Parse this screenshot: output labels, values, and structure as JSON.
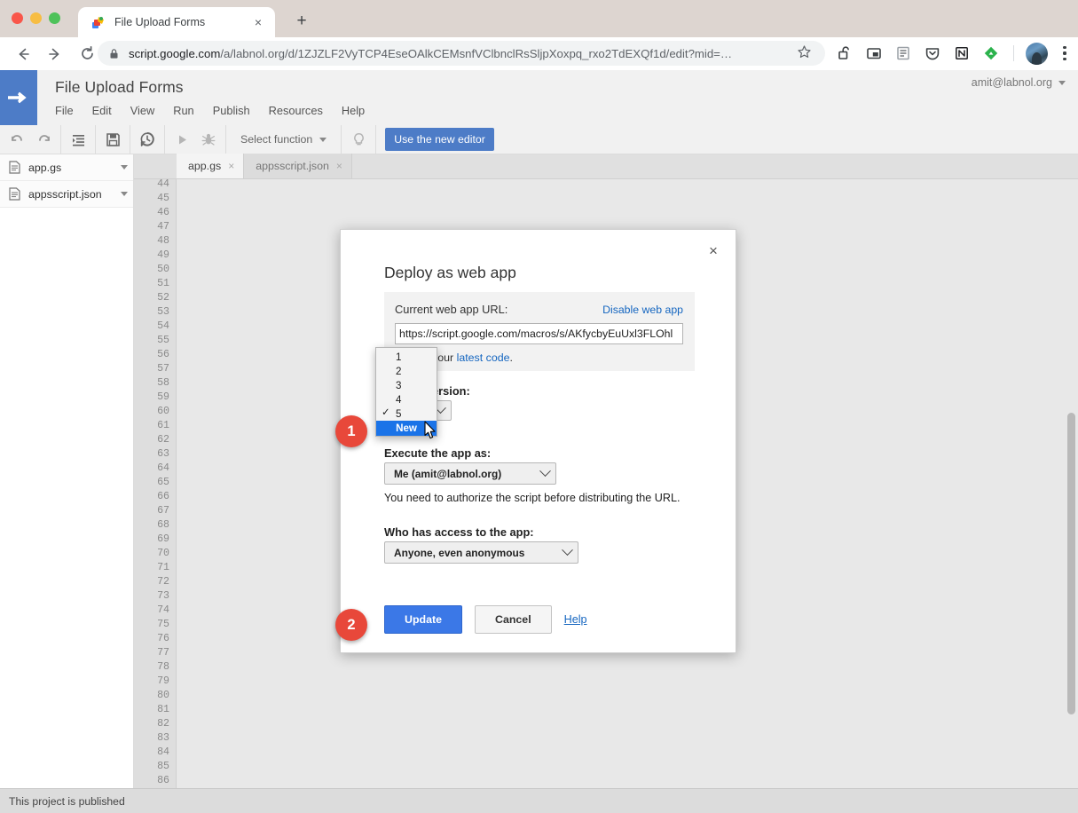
{
  "browser": {
    "tab": {
      "title": "File Upload Forms",
      "favicon": "apps-script-favicon",
      "close": "×"
    },
    "new_tab_label": "+",
    "nav": {
      "back": "←",
      "forward": "→",
      "reload": "⟳"
    },
    "omnibox": {
      "url_secure": "script.google.com",
      "url_path": "/a/labnol.org/d/1ZJZLF2VyTCP4EseOAlkCEMsnfVClbnclRsSljpXoxpq_rxo2TdEXQf1d/edit?mid=…",
      "lock_icon": "lock-icon",
      "star_icon": "star-icon"
    },
    "extensions": [
      {
        "name": "unlock-icon",
        "glyph": "🔓"
      },
      {
        "name": "picture-in-picture-icon",
        "glyph": "▣"
      },
      {
        "name": "reader-mode-icon",
        "glyph": "▤"
      },
      {
        "name": "pocket-icon",
        "glyph": "⛉"
      },
      {
        "name": "notion-icon",
        "glyph": "N"
      },
      {
        "name": "feedly-icon",
        "glyph": "◆"
      }
    ],
    "menu_icon": "kebab-menu-icon"
  },
  "app": {
    "title": "File Upload Forms",
    "account": "amit@labnol.org",
    "menu": [
      "File",
      "Edit",
      "View",
      "Run",
      "Publish",
      "Resources",
      "Help"
    ],
    "toolbar": {
      "undo": "undo-icon",
      "redo": "redo-icon",
      "indent": "indent-icon",
      "save": "save-icon",
      "history": "history-icon",
      "run": "run-icon",
      "debug": "debug-icon",
      "select_function": "Select function",
      "hint": "lightbulb-icon",
      "new_editor": "Use the new editor"
    }
  },
  "files": [
    {
      "name": "app.gs",
      "icon": "file-icon"
    },
    {
      "name": "appsscript.json",
      "icon": "file-icon"
    }
  ],
  "editor": {
    "tabs": [
      {
        "label": "app.gs",
        "active": true,
        "close": "×"
      },
      {
        "label": "appsscript.json",
        "active": false,
        "close": "×"
      }
    ],
    "line_start": 44,
    "line_end": 86
  },
  "status_bar": {
    "message": "This project is published"
  },
  "dialog": {
    "title": "Deploy as web app",
    "close": "×",
    "url_section": {
      "label": "Current web app URL:",
      "disable_link": "Disable web app",
      "url_value": "https://script.google.com/macros/s/AKfycbyEuUxl3FLOhl",
      "note_prefix": "app for your ",
      "note_link": "latest code",
      "note_suffix": "."
    },
    "version": {
      "label": "Project version:",
      "options": [
        "1",
        "2",
        "3",
        "4",
        "5",
        "New"
      ],
      "checked": "5",
      "highlighted": "New"
    },
    "execute": {
      "label": "Execute the app as:",
      "value": "Me (amit@labnol.org)",
      "note": "You need to authorize the script before distributing the URL."
    },
    "access": {
      "label": "Who has access to the app:",
      "value": "Anyone, even anonymous"
    },
    "actions": {
      "update": "Update",
      "cancel": "Cancel",
      "help": "Help"
    }
  },
  "callouts": [
    {
      "number": "1"
    },
    {
      "number": "2"
    }
  ],
  "colors": {
    "accent_blue": "#4d7cc7",
    "button_blue": "#3b78e7",
    "highlight_blue": "#1a73e8",
    "link_blue": "#1566c0",
    "callout_red": "#e8483a"
  }
}
